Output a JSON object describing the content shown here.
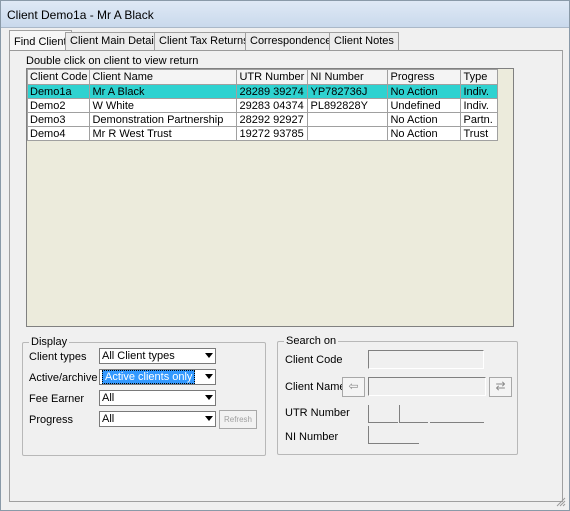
{
  "window": {
    "title": "Client Demo1a - Mr A Black"
  },
  "tabs": [
    {
      "label": "Find Client"
    },
    {
      "label": "Client Main Details"
    },
    {
      "label": "Client Tax Returns"
    },
    {
      "label": "Correspondence"
    },
    {
      "label": "Client Notes"
    }
  ],
  "hint": "Double click on client to view return",
  "table": {
    "headers": [
      "Client Code",
      "Client Name",
      "UTR Number",
      "NI Number",
      "Progress",
      "Type"
    ],
    "rows": [
      [
        "Demo1a",
        "Mr A Black",
        "28289 39274",
        "YP782736J",
        "No Action",
        "Indiv."
      ],
      [
        "Demo2",
        "W White",
        "29283 04374",
        "PL892828Y",
        "Undefined",
        "Indiv."
      ],
      [
        "Demo3",
        "Demonstration Partnership",
        "28292 92927",
        "",
        "No Action",
        "Partn."
      ],
      [
        "Demo4",
        "Mr R West Trust",
        "19272 93785",
        "",
        "No Action",
        "Trust"
      ]
    ],
    "selected_row": 0
  },
  "display": {
    "legend": "Display",
    "client_types_label": "Client types",
    "client_types_value": "All Client types",
    "active_label": "Active/archive",
    "active_value": "Active clients only",
    "fee_earner_label": "Fee Earner",
    "fee_earner_value": "All",
    "progress_label": "Progress",
    "progress_value": "All",
    "refresh_label": "Refresh"
  },
  "search": {
    "legend": "Search on",
    "client_code_label": "Client Code",
    "client_name_label": "Client Name",
    "utr_label": "UTR Number",
    "ni_label": "NI Number"
  },
  "colors": {
    "selection": "#2ed2d0",
    "highlight": "#3399ff"
  }
}
